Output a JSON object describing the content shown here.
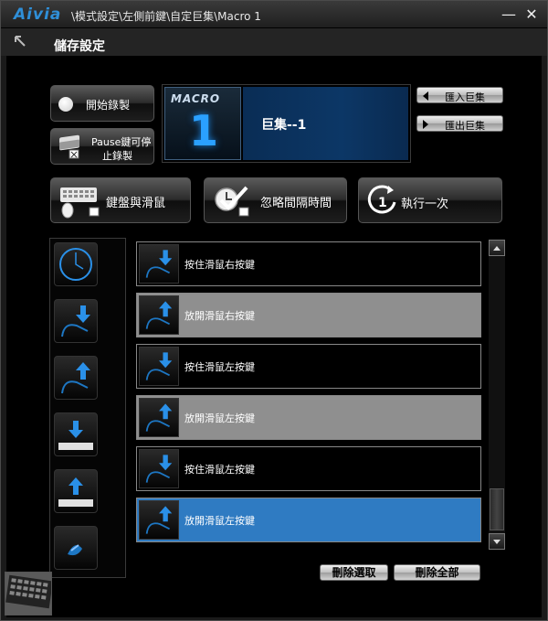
{
  "titlebar": {
    "logo": "Aivia",
    "path": "\\模式設定\\左側前鍵\\自定巨集\\Macro 1",
    "minimize": "—",
    "close": "✕"
  },
  "header": {
    "title": "儲存設定",
    "back_icon": "back-arrow-icon"
  },
  "record": {
    "start_label": "開始錄製",
    "pause_line1": "Pause鍵可停",
    "pause_line2": "止錄製"
  },
  "macro_display": {
    "word": "MACRO",
    "number": "1",
    "name": "巨集--1"
  },
  "io": {
    "import_label": "匯入巨集",
    "export_label": "匯出巨集"
  },
  "big_buttons": {
    "keyboard_mouse": "鍵盤與滑鼠",
    "ignore_interval": "忽略間隔時間",
    "run_once": "執行一次"
  },
  "tools": [
    {
      "name": "timer-icon"
    },
    {
      "name": "mouse-press-icon"
    },
    {
      "name": "mouse-release-icon"
    },
    {
      "name": "key-press-icon"
    },
    {
      "name": "key-release-icon"
    },
    {
      "name": "mouse-scroll-icon"
    }
  ],
  "actions": [
    {
      "label": "按住滑鼠右按鍵",
      "kind": "press",
      "style": "dark"
    },
    {
      "label": "放開滑鼠右按鍵",
      "kind": "release",
      "style": "gray"
    },
    {
      "label": "按住滑鼠左按鍵",
      "kind": "press",
      "style": "dark"
    },
    {
      "label": "放開滑鼠左按鍵",
      "kind": "release",
      "style": "gray"
    },
    {
      "label": "按住滑鼠左按鍵",
      "kind": "press",
      "style": "dark"
    },
    {
      "label": "放開滑鼠左按鍵",
      "kind": "release",
      "style": "selected"
    }
  ],
  "bottom": {
    "delete_selected": "刪除選取",
    "delete_all": "刪除全部"
  },
  "colors": {
    "accent_blue": "#2f7bc2",
    "logo_blue": "#2f8fd8",
    "row_gray": "#8f8f8f"
  }
}
